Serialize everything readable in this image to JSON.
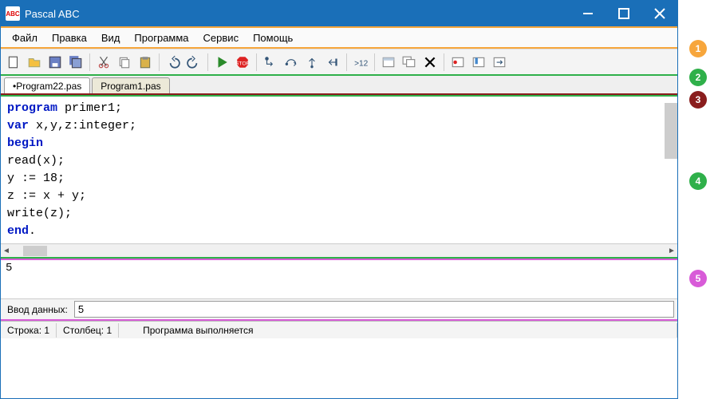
{
  "title": "Pascal ABC",
  "menu": [
    "Файл",
    "Правка",
    "Вид",
    "Программа",
    "Сервис",
    "Помощь"
  ],
  "tabs": [
    {
      "label": "•Program22.pas",
      "active": true
    },
    {
      "label": "Program1.pas",
      "active": false
    }
  ],
  "code_tokens": [
    [
      {
        "t": "program",
        "k": true
      },
      {
        "t": " primer1;"
      }
    ],
    [
      {
        "t": "var",
        "k": true
      },
      {
        "t": " x,y,z:integer;"
      }
    ],
    [
      {
        "t": "begin",
        "k": true
      }
    ],
    [
      {
        "t": "read(x);"
      }
    ],
    [
      {
        "t": "y := 18;"
      }
    ],
    [
      {
        "t": "z := x + y;"
      }
    ],
    [
      {
        "t": "write(z);"
      }
    ],
    [
      {
        "t": "end",
        "k": true
      },
      {
        "t": "."
      }
    ]
  ],
  "output_text": "5",
  "input_label": "Ввод данных:",
  "input_value": "5",
  "status": {
    "line": "Строка: 1",
    "col": "Столбец: 1",
    "msg": "Программа выполняется"
  },
  "badges": [
    "1",
    "2",
    "3",
    "4",
    "5"
  ],
  "toolbar_names": [
    "new-file",
    "open-file",
    "save",
    "save-all",
    "cut",
    "copy",
    "paste",
    "undo",
    "redo",
    "run",
    "stop",
    "step-into",
    "step-over",
    "step-out",
    "step-back",
    "watch",
    "window",
    "windows",
    "delete",
    "breakpoint",
    "bookmark",
    "goto"
  ]
}
